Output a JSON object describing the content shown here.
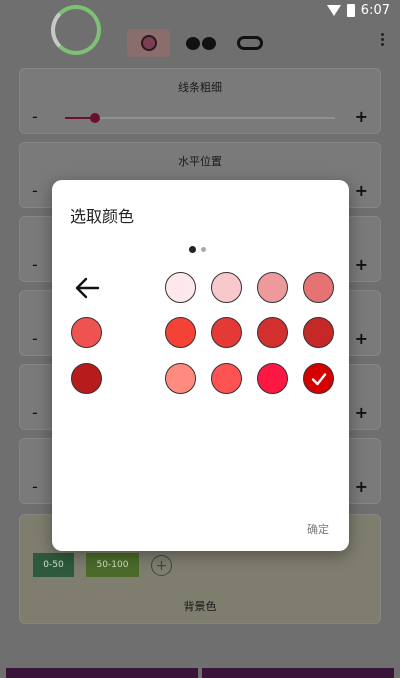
{
  "status": {
    "time": "6:07"
  },
  "toolbar": {
    "shapes": [
      "circle-shape",
      "dual-circle-shape",
      "pill-shape"
    ]
  },
  "cards": {
    "line_width": {
      "title": "线条粗细",
      "minus": "-",
      "plus": "+",
      "level": 0.11
    },
    "horizontal": {
      "title": "水平位置",
      "minus": "-",
      "plus": "+"
    },
    "row3": {
      "minus": "-",
      "plus": "+"
    },
    "row4": {
      "minus": "-",
      "plus": "+"
    },
    "row5": {
      "minus": "-",
      "plus": "+"
    },
    "row6": {
      "minus": "-",
      "plus": "+"
    },
    "background": {
      "range_a": "0-50",
      "range_b": "50-100",
      "label": "背景色"
    }
  },
  "dialog": {
    "title": "选取颜色",
    "ok_label": "确定",
    "page_index": 1,
    "page_count": 2,
    "swatches": [
      {
        "color": "#fde8ec",
        "selected": false
      },
      {
        "color": "#f8c8cd",
        "selected": false
      },
      {
        "color": "#ee9a9c",
        "selected": false
      },
      {
        "color": "#e57373",
        "selected": false
      },
      {
        "color": "#ef5350",
        "selected": false
      },
      {
        "color": "#f44336",
        "selected": false
      },
      {
        "color": "#e53935",
        "selected": false
      },
      {
        "color": "#d32f2f",
        "selected": false
      },
      {
        "color": "#c62828",
        "selected": false
      },
      {
        "color": "#b71c1c",
        "selected": false
      },
      {
        "color": "#ff8a80",
        "selected": false
      },
      {
        "color": "#ff5252",
        "selected": false
      },
      {
        "color": "#ff1744",
        "selected": false
      },
      {
        "color": "#d50000",
        "selected": true
      }
    ]
  }
}
